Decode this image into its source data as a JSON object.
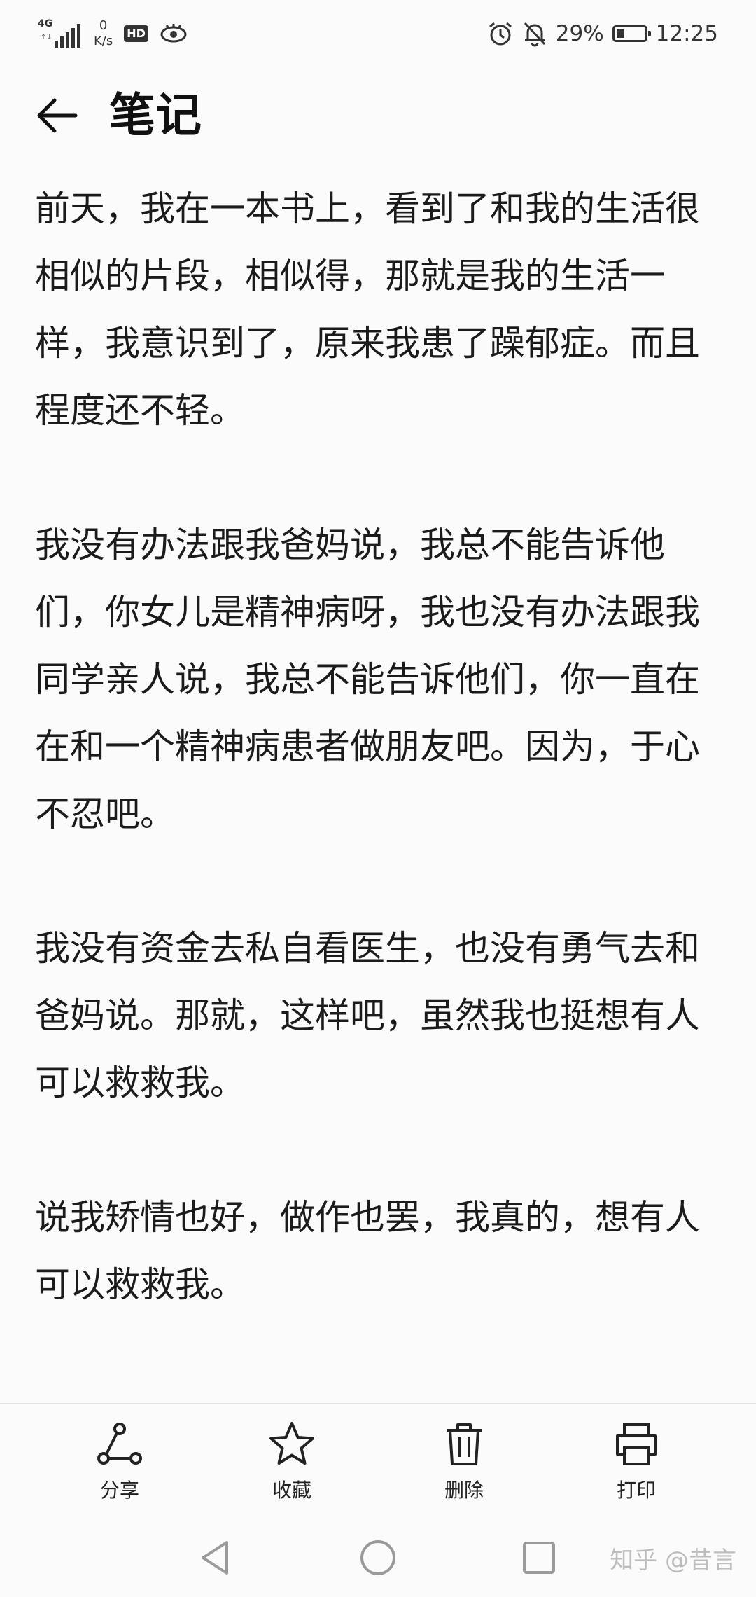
{
  "status_bar": {
    "network": "4G",
    "speed_value": "0",
    "speed_unit": "K/s",
    "hd": "HD",
    "battery": "29%",
    "battery_level": 0.29,
    "time": "12:25"
  },
  "header": {
    "title": "笔记"
  },
  "note": {
    "paragraphs": [
      "前天，我在一本书上，看到了和我的生活很相似的片段，相似得，那就是我的生活一样，我意识到了，原来我患了躁郁症。而且程度还不轻。",
      "我没有办法跟我爸妈说，我总不能告诉他们，你女儿是精神病呀，我也没有办法跟我同学亲人说，我总不能告诉他们，你一直在在和一个精神病患者做朋友吧。因为，于心不忍吧。",
      "我没有资金去私自看医生，也没有勇气去和爸妈说。那就，这样吧，虽然我也挺想有人可以救救我。",
      "说我矫情也好，做作也罢，我真的，想有人可以救救我。"
    ]
  },
  "toolbar": {
    "share": "分享",
    "favorite": "收藏",
    "delete": "删除",
    "print": "打印"
  },
  "watermark": "知乎 @昔言"
}
